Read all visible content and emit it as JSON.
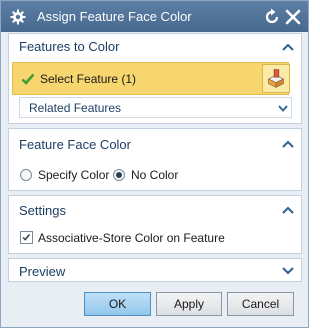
{
  "window": {
    "title": "Assign Feature Face Color"
  },
  "features_section": {
    "title": "Features to Color",
    "select_label": "Select Feature (1)",
    "related_label": "Related Features"
  },
  "color_section": {
    "title": "Feature Face Color",
    "options": [
      {
        "label": "Specify Color",
        "selected": false
      },
      {
        "label": "No Color",
        "selected": true
      }
    ]
  },
  "settings_section": {
    "title": "Settings",
    "checkbox_label": "Associative-Store Color on Feature",
    "checkbox_checked": true
  },
  "preview_section": {
    "title": "Preview"
  },
  "buttons": {
    "ok": "OK",
    "apply": "Apply",
    "cancel": "Cancel"
  },
  "colors": {
    "title_bar": "#46698f",
    "section_title": "#1d3f66",
    "selected_row": "#f7d56f",
    "check_mark": "#3aa02f",
    "primary_button": "#92c7ec"
  }
}
